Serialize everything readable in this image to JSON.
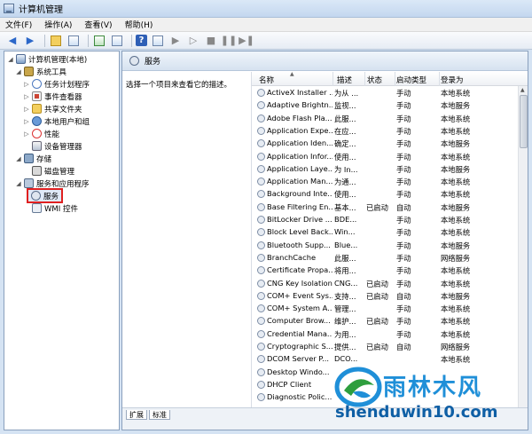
{
  "window": {
    "title": "计算机管理"
  },
  "menu": [
    "文件(F)",
    "操作(A)",
    "查看(V)",
    "帮助(H)"
  ],
  "tree": {
    "root": "计算机管理(本地)",
    "system_tools": "系统工具",
    "task_scheduler": "任务计划程序",
    "event_viewer": "事件查看器",
    "shared_folders": "共享文件夹",
    "local_users": "本地用户和组",
    "performance": "性能",
    "device_manager": "设备管理器",
    "storage": "存储",
    "disk_management": "磁盘管理",
    "services_apps": "服务和应用程序",
    "services": "服务",
    "wmi": "WMI 控件"
  },
  "services_panel": {
    "title": "服务",
    "description_hint": "选择一个项目来查看它的描述。",
    "columns": [
      "名称",
      "描述",
      "状态",
      "启动类型",
      "登录为"
    ],
    "rows": [
      [
        "ActiveX Installer ...",
        "为从 ...",
        "",
        "手动",
        "本地系统"
      ],
      [
        "Adaptive Brightn...",
        "监视...",
        "",
        "手动",
        "本地服务"
      ],
      [
        "Adobe Flash Pla...",
        "此服...",
        "",
        "手动",
        "本地系统"
      ],
      [
        "Application Expe...",
        "在应...",
        "",
        "手动",
        "本地系统"
      ],
      [
        "Application Iden...",
        "确定...",
        "",
        "手动",
        "本地服务"
      ],
      [
        "Application Infor...",
        "使用...",
        "",
        "手动",
        "本地系统"
      ],
      [
        "Application Laye...",
        "为 In...",
        "",
        "手动",
        "本地服务"
      ],
      [
        "Application Man...",
        "为通...",
        "",
        "手动",
        "本地系统"
      ],
      [
        "Background Inte...",
        "使用...",
        "",
        "手动",
        "本地系统"
      ],
      [
        "Base Filtering En...",
        "基本...",
        "已启动",
        "自动",
        "本地服务"
      ],
      [
        "BitLocker Drive ...",
        "BDE...",
        "",
        "手动",
        "本地系统"
      ],
      [
        "Block Level Back...",
        "Win...",
        "",
        "手动",
        "本地系统"
      ],
      [
        "Bluetooth Supp...",
        "Blue...",
        "",
        "手动",
        "本地服务"
      ],
      [
        "BranchCache",
        "此服...",
        "",
        "手动",
        "网络服务"
      ],
      [
        "Certificate Propa...",
        "将用...",
        "",
        "手动",
        "本地系统"
      ],
      [
        "CNG Key Isolation",
        "CNG...",
        "已启动",
        "手动",
        "本地系统"
      ],
      [
        "COM+ Event Sys...",
        "支持...",
        "已启动",
        "自动",
        "本地服务"
      ],
      [
        "COM+ System A...",
        "管理...",
        "",
        "手动",
        "本地系统"
      ],
      [
        "Computer Brow...",
        "维护...",
        "已启动",
        "手动",
        "本地系统"
      ],
      [
        "Credential Mana...",
        "为用...",
        "",
        "手动",
        "本地系统"
      ],
      [
        "Cryptographic S...",
        "提供...",
        "已启动",
        "自动",
        "网络服务"
      ],
      [
        "DCOM Server P...",
        "DCO...",
        "",
        "",
        "本地系统"
      ],
      [
        "Desktop Windo...",
        "",
        "",
        "",
        ""
      ],
      [
        "DHCP Client",
        "",
        "",
        "",
        ""
      ],
      [
        "Diagnostic Polic...",
        "",
        "",
        "",
        ""
      ]
    ]
  },
  "tabs": [
    "扩展",
    "标准"
  ],
  "watermark": {
    "text": "雨林木风",
    "url": "shenduwin10.com"
  },
  "colors": {
    "selection_border": "#e02020",
    "watermark_blue": "#1f8fd8"
  }
}
